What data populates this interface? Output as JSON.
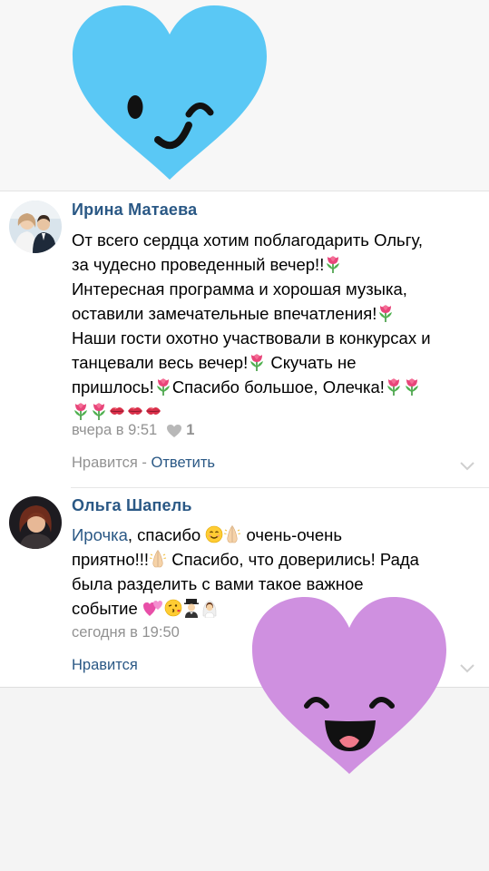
{
  "comments": [
    {
      "author": "Ирина Матаева",
      "lines": [
        "От всего сердца хотим поблагодарить Ольгу,",
        "за чудесно проведенный вечер!!",
        "Интересная программа и хорошая музыка,",
        "оставили замечательные впечатления!",
        "Наши гости охотно участвовали в конкурсах и",
        "танцевали весь вечер!",
        " Скучать не",
        "пришлось!",
        "Спасибо большое, Олечка!"
      ],
      "time": "вчера в 9:51",
      "likes": "1",
      "like_label": "Нравится",
      "separator": " - ",
      "reply_label": "Ответить"
    },
    {
      "author": "Ольга Шапель",
      "mention": "Ирочка",
      "lines": [
        ", спасибо ",
        " очень-очень",
        "приятно!!!",
        " Спасибо, что доверились! Рада",
        "была разделить с вами такое важное",
        "событие "
      ],
      "time": "сегодня в 19:50",
      "like_label": "Нравится"
    }
  ],
  "colors": {
    "link": "#2a5885",
    "meta": "#929292",
    "heart_blue": "#5ac8f5",
    "heart_purple": "#cf90e0"
  },
  "icons": [
    "tulip-emoji",
    "kiss-mark-emoji",
    "smile-emoji",
    "pray-emoji",
    "heart-emoji",
    "kiss-face-emoji",
    "groom-emoji",
    "bride-emoji",
    "heart-like-icon",
    "chevron-down-icon"
  ]
}
